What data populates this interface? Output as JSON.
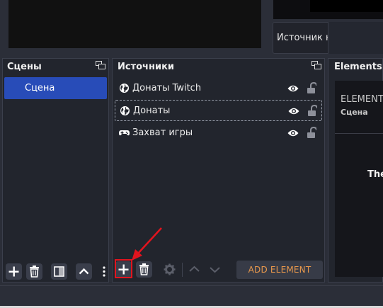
{
  "source_info": {
    "text": "Источник не выбран"
  },
  "scenes_dock": {
    "title": "Сцены",
    "items": [
      {
        "label": "Сцена",
        "selected": true
      }
    ]
  },
  "sources_dock": {
    "title": "Источники",
    "items": [
      {
        "label": "Донаты Twitch",
        "icon": "globe-icon",
        "visible": true,
        "locked": false,
        "selected": false
      },
      {
        "label": "Донаты",
        "icon": "globe-icon",
        "visible": true,
        "locked": false,
        "selected": true
      },
      {
        "label": "Захват игры",
        "icon": "gamepad-icon",
        "visible": true,
        "locked": false,
        "selected": false
      }
    ],
    "add_element_label": "ADD ELEMENT"
  },
  "elements_dock": {
    "title": "Elements C",
    "card_title": "ELEMENT",
    "card_subtitle": "Сцена",
    "card_text": "The"
  },
  "colors": {
    "accent_selected": "#284cb8",
    "highlight_red": "#e2141e",
    "add_element_text": "#e8984c"
  }
}
